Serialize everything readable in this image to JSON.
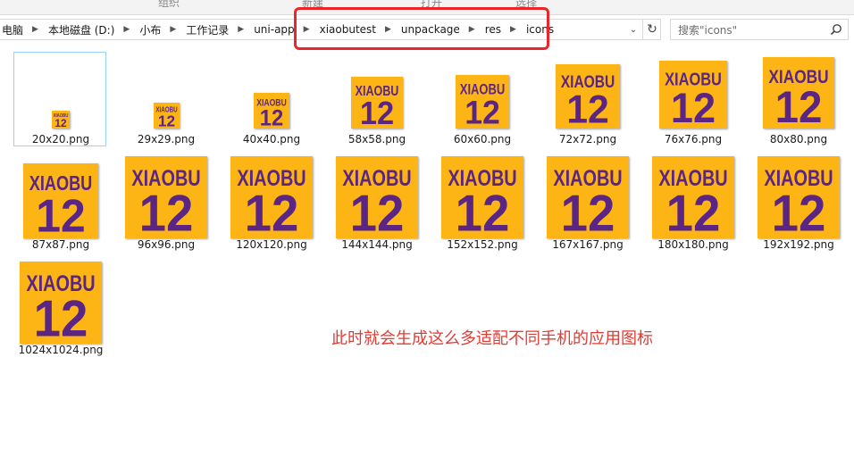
{
  "ribbon": {
    "groups": [
      "组织",
      "新建",
      "打开",
      "选择"
    ]
  },
  "address": {
    "crumbs": [
      "电脑",
      "本地磁盘 (D:)",
      "小布",
      "工作记录",
      "uni-app",
      "xiaobutest",
      "unpackage",
      "res",
      "icons"
    ]
  },
  "search": {
    "placeholder": "搜索\"icons\""
  },
  "files": [
    {
      "name": "20x20.png"
    },
    {
      "name": "29x29.png"
    },
    {
      "name": "40x40.png"
    },
    {
      "name": "58x58.png"
    },
    {
      "name": "60x60.png"
    },
    {
      "name": "72x72.png"
    },
    {
      "name": "76x76.png"
    },
    {
      "name": "80x80.png"
    },
    {
      "name": "87x87.png"
    },
    {
      "name": "96x96.png"
    },
    {
      "name": "120x120.png"
    },
    {
      "name": "144x144.png"
    },
    {
      "name": "152x152.png"
    },
    {
      "name": "167x167.png"
    },
    {
      "name": "180x180.png"
    },
    {
      "name": "192x192.png"
    },
    {
      "name": "1024x1024.png"
    }
  ],
  "icon_art": {
    "word": "XIAOBU",
    "number": "12",
    "bg": "#fdb515",
    "fg": "#5b2583"
  },
  "annotation": "此时就会生成这么多适配不同手机的应用图标",
  "colors": {
    "highlight": "#e8262b",
    "annotation": "#e23b32",
    "selection_border": "#99d1ff"
  }
}
